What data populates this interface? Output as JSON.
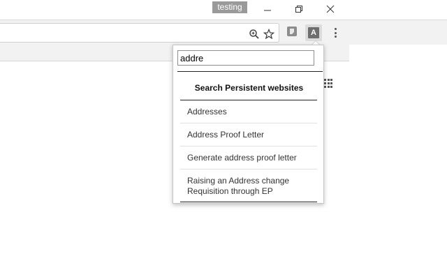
{
  "window": {
    "profile_label": "testing",
    "controls": [
      "minimize-icon",
      "restore-icon",
      "close-icon"
    ]
  },
  "toolbar": {
    "icons": [
      "zoom-icon",
      "star-icon",
      "extension-icon",
      "extension-a-icon",
      "kebab-menu-icon"
    ],
    "active_extension_letter": "A"
  },
  "popup": {
    "search_value": "addre",
    "heading": "Search Persistent websites",
    "results": [
      {
        "label": "Addresses"
      },
      {
        "label": "Address Proof Letter"
      },
      {
        "label": "Generate address proof letter"
      },
      {
        "label": "Raising an Address change Requisition through EP"
      }
    ]
  },
  "colors": {
    "profile_tag_bg": "#9a9a9a",
    "toolbar_bg": "#f2f2f2",
    "popup_border": "#c6c6c6",
    "rule": "#222222"
  }
}
